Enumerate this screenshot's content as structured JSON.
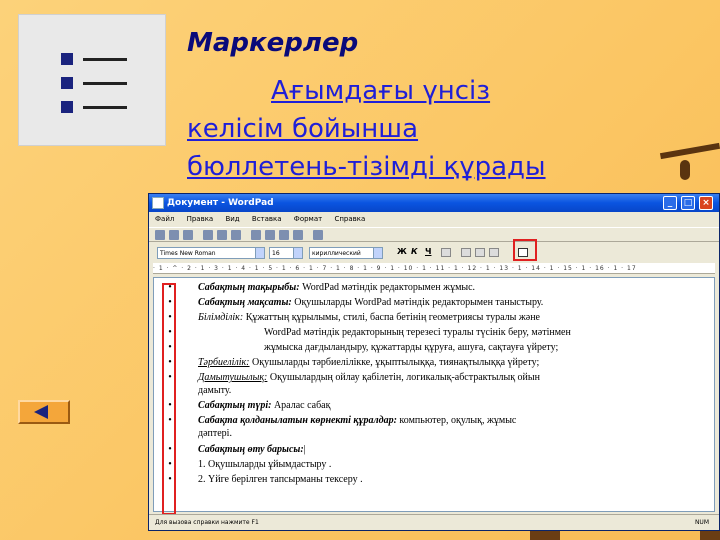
{
  "slide": {
    "title": "Маркерлер",
    "body_lines": [
      "Ағымдағы үнсіз",
      "келісім бойынша",
      "бюллетень-тізімді құрады"
    ]
  },
  "window": {
    "title": "Документ - WordPad",
    "menu": [
      "Файл",
      "Правка",
      "Вид",
      "Вставка",
      "Формат",
      "Справка"
    ],
    "font_name": "Times New Roman",
    "font_size": "16",
    "charset": "кириллический",
    "format_buttons": [
      "Ж",
      "К",
      "Ч"
    ],
    "ruler_text": "· 1 · ^ · 2 · 1 · 3 · 1 · 4 · 1 · 5 · 1 · 6 · 1 · 7 · 1 · 8 · 1 · 9 · 1 · 10 · 1 · 11 · 1 · 12 · 1 · 13 · 1 · 14 · 1 · 15 · 1 · 16 · 1 · 17",
    "status_text": "Для вызова справки нажмите F1",
    "status_num": "NUM"
  },
  "document": {
    "lines": [
      {
        "bullet": "•",
        "label": "Сабақтың тақырыбы:",
        "label_style": "bold-italic",
        "text": " WordPad мәтіндік редакторымен жұмыс."
      },
      {
        "bullet": "•",
        "label": "Сабақтың мақсаты:",
        "label_style": "bold-italic",
        "text": " Оқушыларды WordPad мәтіндік редакторымен таныстыру."
      },
      {
        "bullet": "•",
        "label": "Білімділік:",
        "label_style": "italic",
        "text": "     Құжаттың құрылымы, стилі, баспа бетінің геометриясы туралы және"
      },
      {
        "bullet": "•",
        "label": "",
        "label_style": "indent",
        "text": "WordPad мәтіндік редакторының терезесі туралы түсінік беру, мәтінмен"
      },
      {
        "bullet": "•",
        "label": "",
        "label_style": "indent",
        "text": "жұмыска дағдыландыру, құжаттарды құруға, ашуға, сақтауға үйрету;"
      },
      {
        "bullet": "•",
        "label": "Тәрбиелілік:",
        "label_style": "italic-underline",
        "text": " Оқушыларды тәрбиелілікке, ұқыптылыққа, тиянақтылыққа үйрету;"
      },
      {
        "bullet": "•",
        "label": "Дамытушылық:",
        "label_style": "italic-underline",
        "text": " Оқушылардың ойлау қабілетін, логикалық-абстрактылық ойын"
      },
      {
        "bullet": "",
        "label": "",
        "label_style": "plain",
        "text": "дамыту."
      },
      {
        "bullet": "•",
        "label": "Сабақтың түрі:",
        "label_style": "bold-italic",
        "text": " Аралас сабақ"
      },
      {
        "bullet": "•",
        "label": "Сабақта қолданылатын көрнекті құралдар:",
        "label_style": "bold-italic",
        "text": " компьютер, оқулық, жұмыс"
      },
      {
        "bullet": "",
        "label": "",
        "label_style": "plain",
        "text": "дәптері."
      },
      {
        "bullet": "•",
        "label": "Сабақтың өту барысы:",
        "label_style": "bold-italic",
        "text": ""
      },
      {
        "bullet": "•",
        "label": "",
        "label_style": "plain",
        "text": "1.     Оқушыларды ұйымдастыру ."
      },
      {
        "bullet": "•",
        "label": "",
        "label_style": "plain",
        "text": "2.     Үйге берілген тапсырманы тексеру ."
      }
    ]
  },
  "colors": {
    "slide_bg": "#fbc968",
    "title": "#0a0a7a",
    "link": "#1f1fd8",
    "highlight": "#e02020",
    "window_title": "#0a54e0"
  },
  "icons": [
    "bulleted-list-icon",
    "back-arrow-icon",
    "bullets-button-icon"
  ]
}
